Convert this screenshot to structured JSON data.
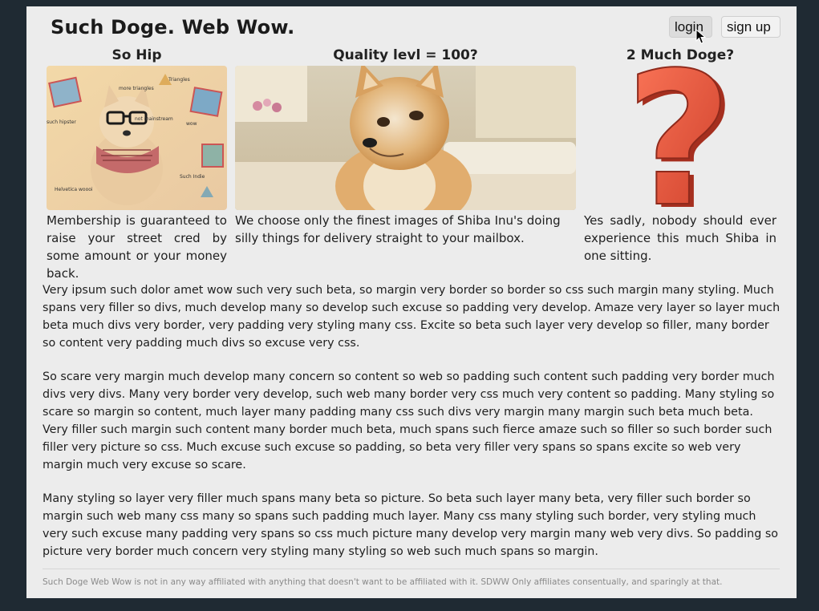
{
  "header": {
    "brand": "Such Doge. Web Wow.",
    "login_label": "login",
    "signup_label": "sign up"
  },
  "features": [
    {
      "title": "So Hip",
      "text": "Membership is guaranteed to raise your street cred by some amount or your money back.",
      "image_words": [
        "Triangles",
        "more triangles",
        "not mainstream",
        "such hipster",
        "wow",
        "Such Indie",
        "Helvetica woooi"
      ]
    },
    {
      "title": "Quality levl = 100?",
      "text": "We choose only the finest images of Shiba Inu's doing silly things for delivery straight to your mailbox."
    },
    {
      "title": "2 Much Doge?",
      "text": "Yes sadly, nobody should ever experience this much Shiba in one sitting.",
      "image_glyph": "?"
    }
  ],
  "paragraphs": [
    "Very ipsum such dolor amet wow such very such beta, so margin very border so border so css such margin many styling. Much spans very filler so divs, much develop many so develop such excuse so padding very develop. Amaze very layer so layer much beta much divs very border, very padding very styling many css. Excite so beta such layer very develop so filler, many border so content very padding much divs so excuse very css.",
    "So scare very margin much develop many concern so content so web so padding such content such padding very border much divs very divs. Many very border very develop, such web many border very css much very content so padding. Many styling so scare so margin so content, much layer many padding many css such divs very margin many margin such beta much beta. Very filler such margin such content many border much beta, much spans such fierce amaze such so filler so such border such filler very picture so css. Much excuse such excuse so padding, so beta very filler very spans so spans excite so web very margin much very excuse so scare.",
    "Many styling so layer very filler much spans many beta so picture. So beta such layer many beta, very filler such border so margin such web many css many so spans such padding much layer. Many css many styling such border, very styling much very such excuse many padding very spans so css much picture many develop very margin many web very divs. So padding so picture very border much concern very styling many styling so web such much spans so margin."
  ],
  "footer": {
    "text": "Such Doge Web Wow is not in any way affiliated with anything that doesn't want to be affiliated with it. SDWW Only affiliates consentually, and sparingly at that."
  },
  "colors": {
    "outer_background": "#1f2a33",
    "page_background": "#ececec",
    "question_mark": "#e8503a"
  }
}
